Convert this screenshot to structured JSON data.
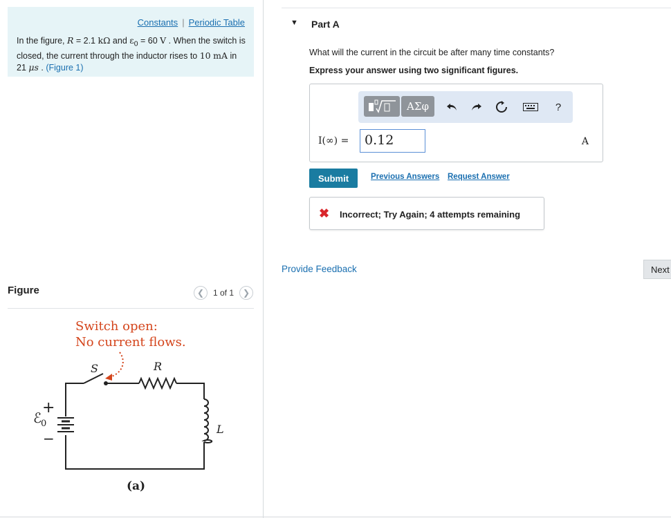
{
  "links": {
    "constants": "Constants",
    "separator": "|",
    "periodic_table": "Periodic Table"
  },
  "problem": {
    "text_1": "In the figure, ",
    "R_sym": "R",
    "text_2": " = 2.1 ",
    "R_unit": "kΩ",
    "text_3": " and ",
    "E_sym": "ε",
    "E_sub": "0",
    "text_4": " = 60 ",
    "E_unit": "V",
    "text_5": " . When the switch is closed, the current through the inductor rises to ",
    "I_val": "10",
    "I_unit": "mA",
    "text_6": " in 21 ",
    "t_unit": "μs",
    "text_7": " . ",
    "fig_link": "(Figure 1)"
  },
  "figure": {
    "title": "Figure",
    "pager": "1 of 1",
    "prev_icon": "chevron-left-icon",
    "next_icon": "chevron-right-icon",
    "caption_1": "Switch open:",
    "caption_2": "No current flows.",
    "label_S": "S",
    "label_R": "R",
    "label_L": "L",
    "label_E": "ℰ",
    "label_E_sub": "0",
    "label_plus": "+",
    "label_minus": "−",
    "label_a": "(a)",
    "caption_color": "#d4451c"
  },
  "part": {
    "toggle_icon": "triangle-down-icon",
    "title": "Part A"
  },
  "question": "What will the current in the circuit be after many time constants?",
  "instruction": "Express your answer using two significant figures.",
  "toolbar": {
    "templates_icon": "sqrt-template-icon",
    "greek_label": "ΑΣφ",
    "undo_icon": "undo-icon",
    "redo_icon": "redo-icon",
    "reset_icon": "reset-icon",
    "keyboard_icon": "keyboard-icon",
    "help_label": "?"
  },
  "answer": {
    "label": "I(∞) =",
    "value": "0.12",
    "unit": "A"
  },
  "buttons": {
    "submit": "Submit",
    "previous_answers": "Previous Answers",
    "request_answer": "Request Answer",
    "provide_feedback": "Provide Feedback",
    "next": "Next"
  },
  "feedback": {
    "icon": "x-mark-icon",
    "message": "Incorrect; Try Again; 4 attempts remaining"
  },
  "colors": {
    "accent": "#1a7ca1",
    "link": "#1a6fb0",
    "error": "#d9262b",
    "info_bg": "#e6f4f7"
  }
}
